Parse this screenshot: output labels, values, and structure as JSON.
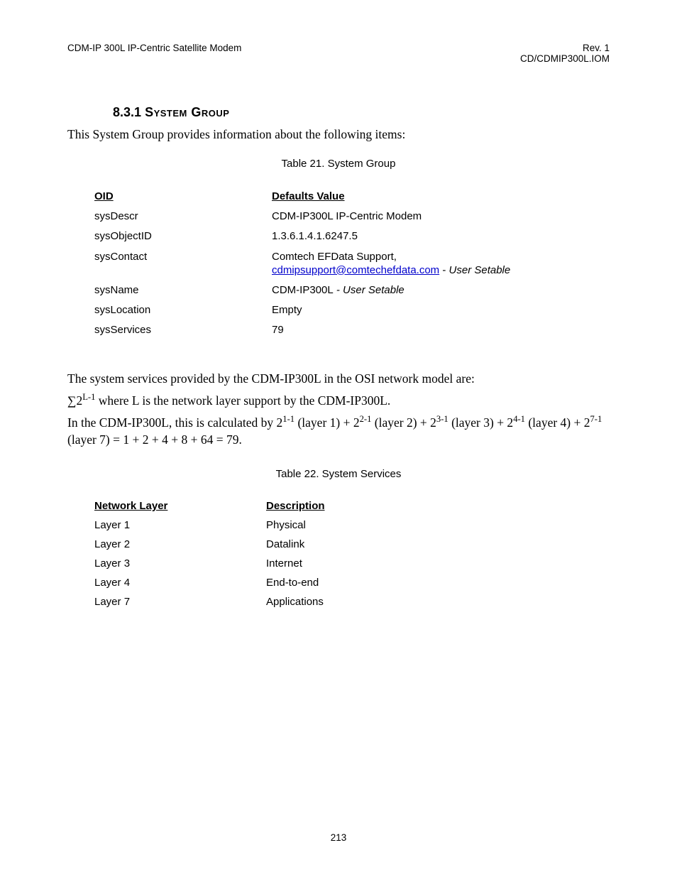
{
  "header": {
    "left": "CDM-IP 300L IP-Centric Satellite Modem",
    "right_line1": "Rev. 1",
    "right_line2": "CD/CDMIP300L.IOM"
  },
  "section": {
    "number": "8.3.1",
    "title_smallcaps": "System Group",
    "intro": "This System Group provides information about the following items:"
  },
  "table21": {
    "caption": "Table 21. System Group",
    "head_oid": "OID",
    "head_val": "Defaults Value",
    "rows": {
      "sysDescr": {
        "oid": "sysDescr",
        "val": "CDM-IP300L IP-Centric Modem"
      },
      "sysObjectID": {
        "oid": "sysObjectID",
        "val": "1.3.6.1.4.1.6247.5"
      },
      "sysContact": {
        "oid": "sysContact",
        "prefix": "Comtech EFData Support, ",
        "email": "cdmipsupport@comtechefdata.com",
        "sep": " - ",
        "suffix": "User Setable"
      },
      "sysName": {
        "oid": "sysName",
        "prefix": "CDM-IP300L",
        "sep": " - ",
        "suffix": "User Setable"
      },
      "sysLocation": {
        "oid": "sysLocation",
        "val": "Empty"
      },
      "sysServices": {
        "oid": "sysServices",
        "val": "79"
      }
    }
  },
  "body": {
    "p1": "The system services provided by the CDM-IP300L in the OSI network model are:",
    "formula_sigma": "∑2",
    "formula_exp": "L-1",
    "formula_tail": "   where L is the network layer support by the CDM-IP300L.",
    "calc_a": "In the CDM-IP300L, this is calculated by 2",
    "e1": "1-1",
    "calc_b": " (layer 1) + 2",
    "e2": "2-1",
    "calc_c": " (layer 2) + 2",
    "e3": "3-1",
    "calc_d": " (layer 3) + 2",
    "e4": "4-1",
    "calc_e": " (layer 4) + 2",
    "e5": "7-1",
    "calc_f": " (layer 7) =  1 + 2 + 4 + 8 + 64 = 79."
  },
  "table22": {
    "caption": "Table 22. System Services",
    "head_layer": "Network Layer",
    "head_desc": "Description",
    "rows": [
      {
        "layer": "Layer 1",
        "desc": "Physical"
      },
      {
        "layer": "Layer 2",
        "desc": "Datalink"
      },
      {
        "layer": "Layer 3",
        "desc": "Internet"
      },
      {
        "layer": "Layer 4",
        "desc": "End-to-end"
      },
      {
        "layer": "Layer 7",
        "desc": "Applications"
      }
    ]
  },
  "page_number": "213"
}
